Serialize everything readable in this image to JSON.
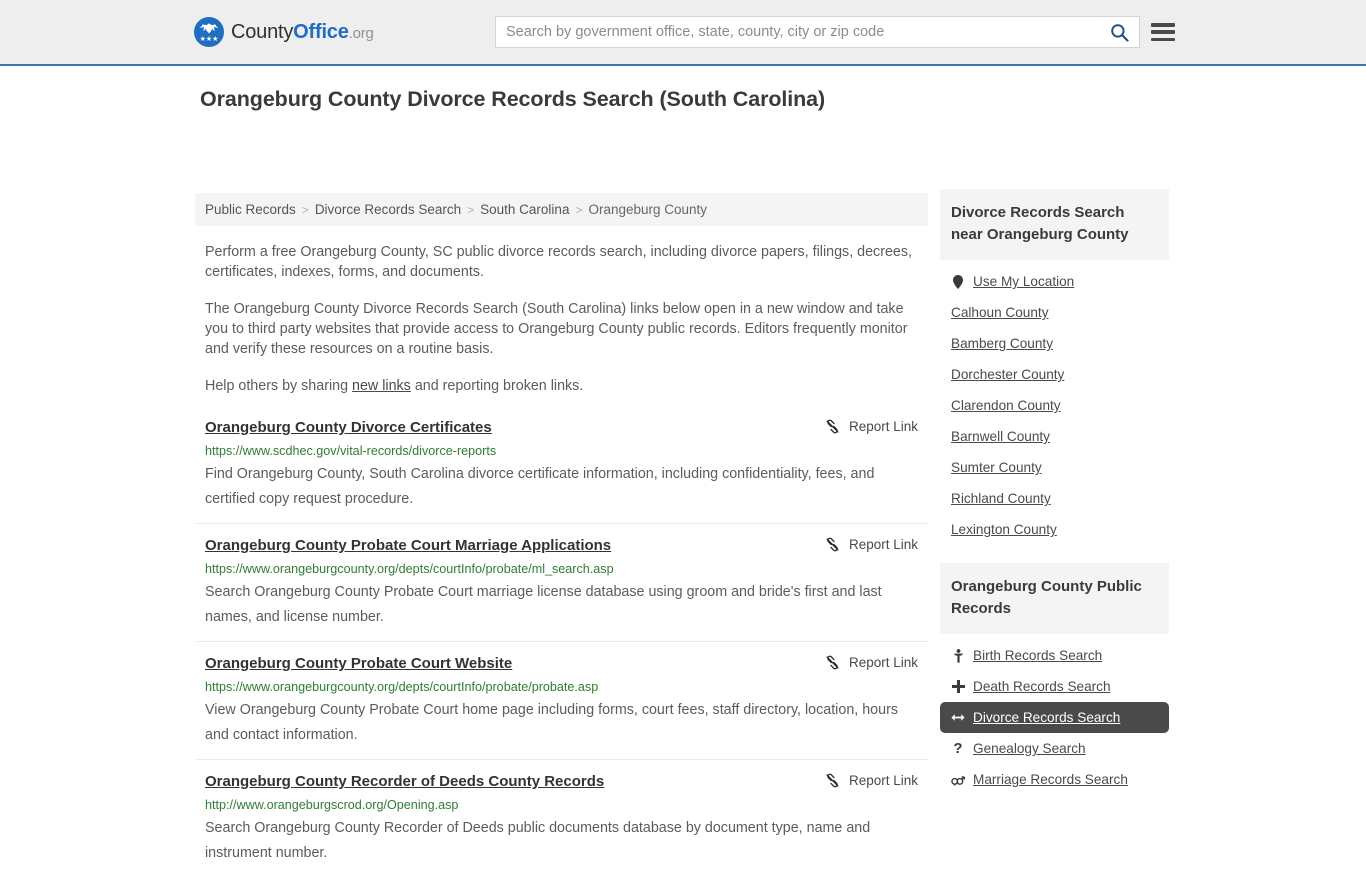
{
  "header": {
    "logo": {
      "part1": "County",
      "part2": "Office",
      "part3": ".org",
      "stars": "★★★"
    },
    "search": {
      "placeholder": "Search by government office, state, county, city or zip code",
      "value": ""
    },
    "search_icon": "search-icon",
    "menu_icon": "hamburger-menu-icon"
  },
  "page": {
    "title": "Orangeburg County Divorce Records Search (South Carolina)"
  },
  "breadcrumb": {
    "items": [
      {
        "label": "Public Records",
        "current": false
      },
      {
        "label": "Divorce Records Search",
        "current": false
      },
      {
        "label": "South Carolina",
        "current": false
      },
      {
        "label": "Orangeburg County",
        "current": true
      }
    ],
    "separator": ">"
  },
  "intro": {
    "p1": "Perform a free Orangeburg County, SC public divorce records search, including divorce papers, filings, decrees, certificates, indexes, forms, and documents.",
    "p2": "The Orangeburg County Divorce Records Search (South Carolina) links below open in a new window and take you to third party websites that provide access to Orangeburg County public records. Editors frequently monitor and verify these resources on a routine basis.",
    "p3_before": "Help others by sharing ",
    "p3_link": "new links",
    "p3_after": " and reporting broken links."
  },
  "report_link_label": "Report Link",
  "results": [
    {
      "title": "Orangeburg County Divorce Certificates",
      "url": "https://www.scdhec.gov/vital-records/divorce-reports",
      "description": "Find Orangeburg County, South Carolina divorce certificate information, including confidentiality, fees, and certified copy request procedure.",
      "report": "Report Link"
    },
    {
      "title": "Orangeburg County Probate Court Marriage Applications",
      "url": "https://www.orangeburgcounty.org/depts/courtInfo/probate/ml_search.asp",
      "description": "Search Orangeburg County Probate Court marriage license database using groom and bride's first and last names, and license number.",
      "report": "Report Link"
    },
    {
      "title": "Orangeburg County Probate Court Website",
      "url": "https://www.orangeburgcounty.org/depts/courtInfo/probate/probate.asp",
      "description": "View Orangeburg County Probate Court home page including forms, court fees, staff directory, location, hours and contact information.",
      "report": "Report Link"
    },
    {
      "title": "Orangeburg County Recorder of Deeds County Records",
      "url": "http://www.orangeburgscrod.org/Opening.asp",
      "description": "Search Orangeburg County Recorder of Deeds public documents database by document type, name and instrument number.",
      "report": "Report Link"
    }
  ],
  "sidebar": {
    "nearby": {
      "heading": "Divorce Records Search near Orangeburg County",
      "items": [
        {
          "label": "Use My Location",
          "icon": "location-pin-icon",
          "glyph": "⮟",
          "active": false
        },
        {
          "label": "Calhoun County",
          "icon": "",
          "glyph": "",
          "active": false
        },
        {
          "label": "Bamberg County",
          "icon": "",
          "glyph": "",
          "active": false
        },
        {
          "label": "Dorchester County",
          "icon": "",
          "glyph": "",
          "active": false
        },
        {
          "label": "Clarendon County",
          "icon": "",
          "glyph": "",
          "active": false
        },
        {
          "label": "Barnwell County",
          "icon": "",
          "glyph": "",
          "active": false
        },
        {
          "label": "Sumter County",
          "icon": "",
          "glyph": "",
          "active": false
        },
        {
          "label": "Richland County",
          "icon": "",
          "glyph": "",
          "active": false
        },
        {
          "label": "Lexington County",
          "icon": "",
          "glyph": "",
          "active": false
        }
      ]
    },
    "public_records": {
      "heading": "Orangeburg County Public Records",
      "items": [
        {
          "label": "Birth Records Search",
          "icon": "baby-icon",
          "glyph": "Ɣ",
          "active": false
        },
        {
          "label": "Death Records Search",
          "icon": "cross-icon",
          "glyph": "✚",
          "active": false
        },
        {
          "label": "Divorce Records Search",
          "icon": "left-right-arrow-icon",
          "glyph": "↔",
          "active": true
        },
        {
          "label": "Genealogy Search",
          "icon": "question-mark-icon",
          "glyph": "?",
          "active": false
        },
        {
          "label": "Marriage Records Search",
          "icon": "gender-symbols-icon",
          "glyph": "⚥",
          "active": false
        }
      ]
    }
  },
  "colors": {
    "header_bg": "#eeeeee",
    "header_border": "#3b73a8",
    "brand_blue": "#1f6ec2",
    "url_green": "#2f7d32",
    "active_bg": "#4a4a4a",
    "panel_bg": "#f4f4f4"
  }
}
